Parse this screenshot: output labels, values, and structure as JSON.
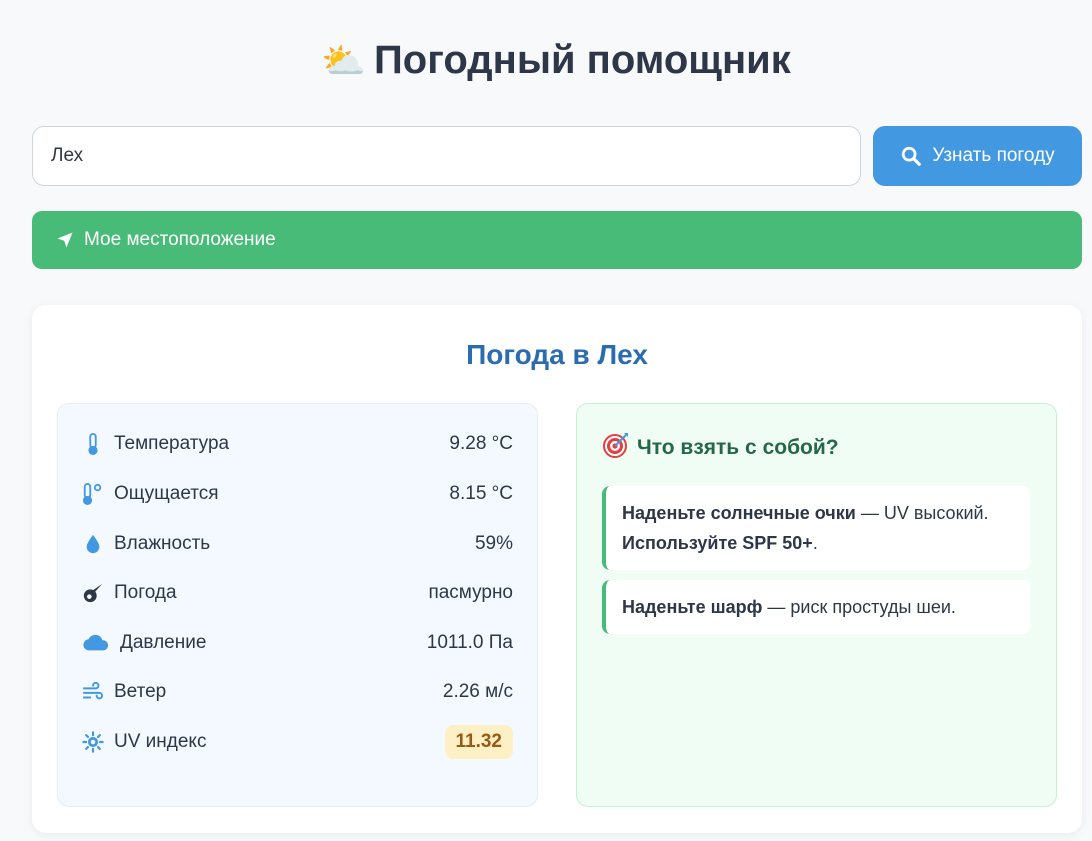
{
  "header": {
    "icon": "sun-behind-cloud-icon",
    "title": "Погодный помощник"
  },
  "search": {
    "value": "Лех",
    "button_label": "Узнать погоду"
  },
  "location_button": {
    "label": "Мое местоположение"
  },
  "weather": {
    "title": "Погода в Лех",
    "rows": [
      {
        "icon": "thermometer-icon",
        "label": "Температура",
        "value": "9.28 °C"
      },
      {
        "icon": "thermometer-feels-icon",
        "label": "Ощущается",
        "value": "8.15 °C"
      },
      {
        "icon": "droplet-icon",
        "label": "Влажность",
        "value": "59%"
      },
      {
        "icon": "meteor-icon",
        "label": "Погода",
        "value": "пасмурно"
      },
      {
        "icon": "cloud-icon",
        "label": "Давление",
        "value": "1011.0 Па"
      },
      {
        "icon": "wind-icon",
        "label": "Ветер",
        "value": "2.26 м/с"
      },
      {
        "icon": "sun-icon",
        "label": "UV индекс",
        "value": "11.32"
      }
    ]
  },
  "advice": {
    "title": "Что взять с собой?",
    "items": [
      {
        "bold1": "Наденьте солнечные очки",
        "text1": " — UV высокий. ",
        "bold2": "Используйте SPF 50+",
        "text2": "."
      },
      {
        "bold1": "Наденьте шарф",
        "text1": " — риск простуды шеи."
      }
    ]
  },
  "colors": {
    "primary": "#4299e1",
    "success": "#48bb78",
    "title_blue": "#2b6cb0",
    "advice_green": "#276749",
    "uv_badge_bg": "#fdf0c4"
  }
}
